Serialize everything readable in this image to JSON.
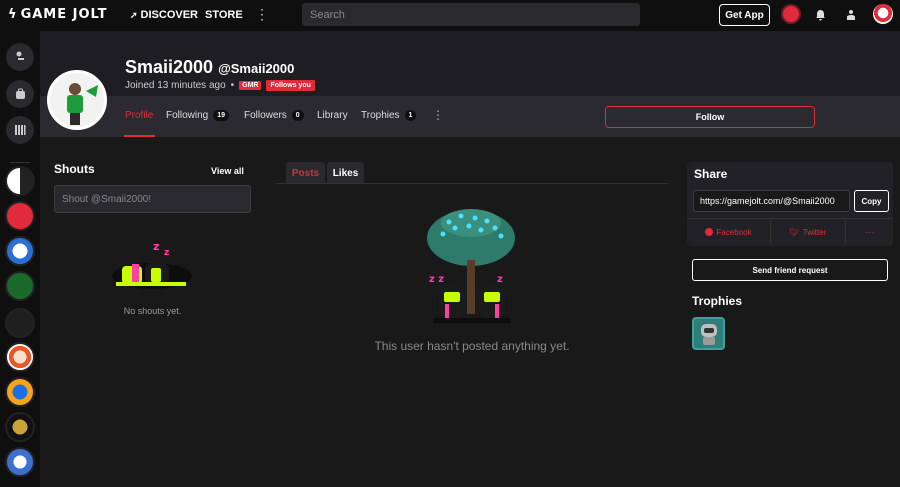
{
  "topbar": {
    "logo": "GAME JOLT",
    "discover": "DISCOVER",
    "store": "STORE",
    "more": "⋮",
    "search_placeholder": "Search",
    "get_app": "Get App"
  },
  "profile": {
    "display_name": "Smaii2000",
    "handle": "@Smaii2000",
    "joined": "Joined 13 minutes ago",
    "badges": [
      "GMR",
      "Follows you"
    ],
    "follow_label": "Follow"
  },
  "tabs": [
    {
      "label": "Profile",
      "count": ""
    },
    {
      "label": "Following",
      "count": "19"
    },
    {
      "label": "Followers",
      "count": "0"
    },
    {
      "label": "Library",
      "count": ""
    },
    {
      "label": "Trophies",
      "count": "1"
    }
  ],
  "shouts": {
    "title": "Shouts",
    "view_all": "View all",
    "placeholder": "Shout @Smaii2000!",
    "empty": "No shouts yet."
  },
  "posts": {
    "tabs": [
      "Posts",
      "Likes"
    ],
    "empty": "This user hasn't posted anything yet."
  },
  "share": {
    "title": "Share",
    "url": "https://gamejolt.com/@Smaii2000",
    "copy": "Copy",
    "facebook": "Facebook",
    "twitter": "Twitter",
    "more": "···",
    "friend_request": "Send friend request"
  },
  "trophies": {
    "title": "Trophies"
  },
  "colors": {
    "accent": "#e12b3b",
    "background": "#191919",
    "bar": "#0f0f0f"
  }
}
